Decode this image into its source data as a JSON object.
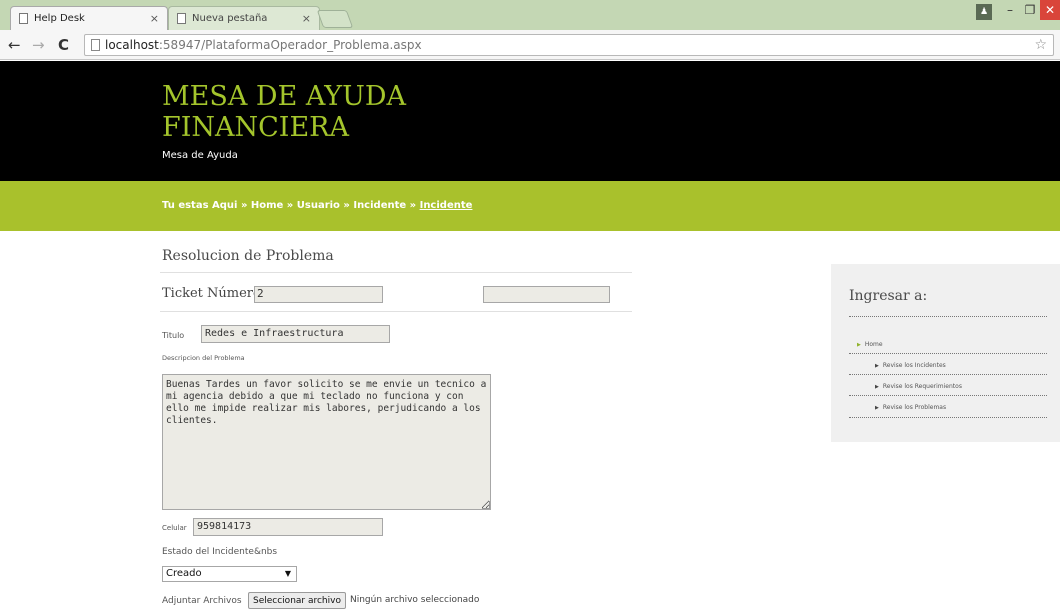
{
  "browser": {
    "tabs": [
      {
        "title": "Help Desk",
        "active": true
      },
      {
        "title": "Nueva pestaña",
        "active": false
      }
    ],
    "url_host": "localhost",
    "url_rest": ":58947/PlataformaOperador_Problema.aspx",
    "close_glyph": "×",
    "back_glyph": "←",
    "forward_glyph": "→",
    "reload_glyph": "C",
    "star_glyph": "☆",
    "min_glyph": "–",
    "max_glyph": "❐",
    "win_close_glyph": "✕",
    "user_glyph": "♟"
  },
  "header": {
    "title": "MESA DE AYUDA FINANCIERA",
    "subtitle": "Mesa de Ayuda"
  },
  "breadcrumb": {
    "prefix": "Tu estas Aqui » Home » Usuario » Incidente » ",
    "current": "Incidente"
  },
  "form": {
    "section_title": "Resolucion de Problema",
    "ticket_label": "Ticket Número:",
    "ticket_value": "2",
    "titulo_label": "Titulo",
    "titulo_value": "Redes e Infraestructura",
    "descripcion_label": "Descripcion del Problema",
    "descripcion_value": "Buenas Tardes un favor solicito se me envie un tecnico a mi agencia debido a que mi teclado no funciona y con ello me impide realizar mis labores, perjudicando a los clientes.",
    "celular_label": "Celular",
    "celular_value": "959814173",
    "estado_label": "Estado del Incidente&nbs",
    "estado_value": "Creado",
    "adjuntar_label": "Adjuntar Archivos",
    "file_button": "Seleccionar archivo",
    "file_status": "Ningún archivo seleccionado"
  },
  "sidebar": {
    "title": "Ingresar a:",
    "items": [
      {
        "label": "Home"
      },
      {
        "label": "Revise los Incidentes"
      },
      {
        "label": "Revise los Requerimientos"
      },
      {
        "label": "Revise los Problemas"
      }
    ]
  },
  "colors": {
    "accent_green": "#a9c12c",
    "title_green": "#a4c52c",
    "header_bg": "#000000"
  }
}
